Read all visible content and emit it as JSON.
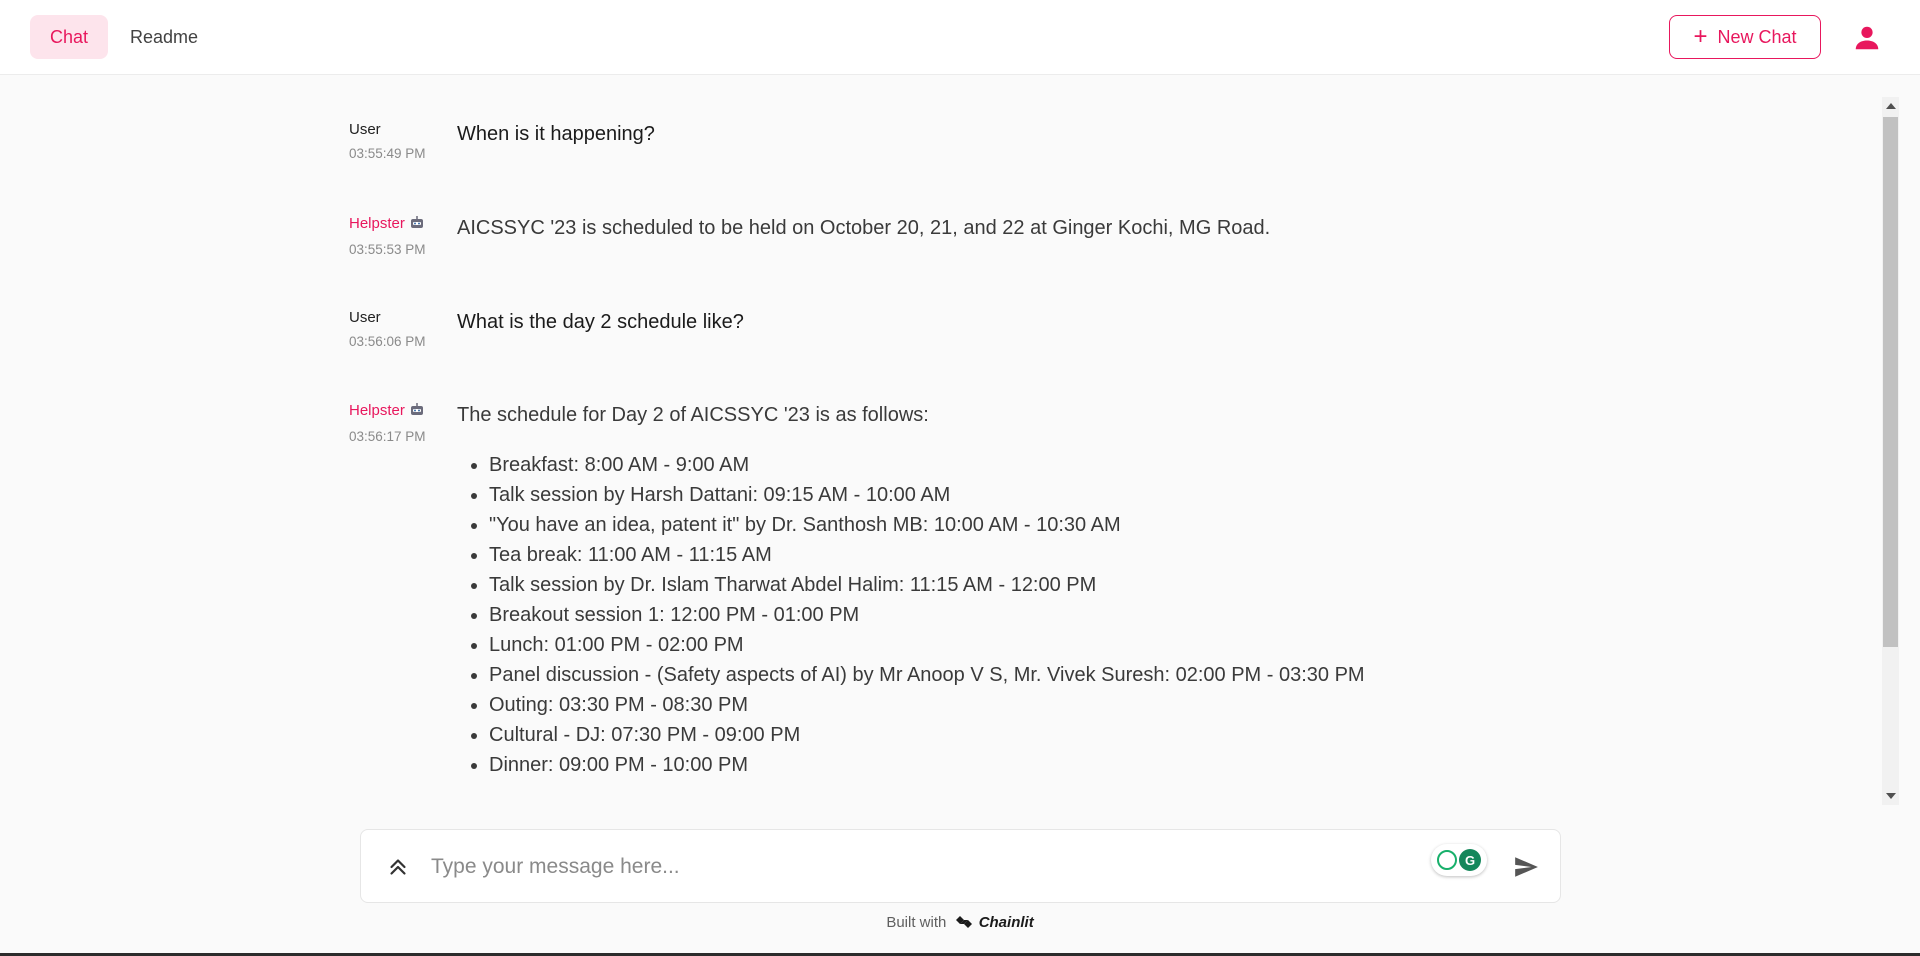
{
  "header": {
    "tabs": [
      {
        "label": "Chat",
        "active": true
      },
      {
        "label": "Readme",
        "active": false
      }
    ],
    "new_chat_label": "New Chat",
    "account_icon": "account-icon"
  },
  "colors": {
    "accent": "#e8175d",
    "active_tab_bg": "#fde4ec",
    "background": "#fafafa"
  },
  "messages": [
    {
      "author": "User",
      "time": "03:55:49 PM",
      "text": "When is it happening?"
    },
    {
      "author": "Helpster",
      "time": "03:55:53 PM",
      "text": "AICSSYC '23 is scheduled to be held on October 20, 21, and 22 at Ginger Kochi, MG Road."
    },
    {
      "author": "User",
      "time": "03:56:06 PM",
      "text": "What is the day 2 schedule like?"
    },
    {
      "author": "Helpster",
      "time": "03:56:17 PM",
      "text": "The schedule for Day 2 of AICSSYC '23 is as follows:",
      "items": [
        "Breakfast: 8:00 AM - 9:00 AM",
        "Talk session by Harsh Dattani: 09:15 AM - 10:00 AM",
        "\"You have an idea, patent it\" by Dr. Santhosh MB: 10:00 AM - 10:30 AM",
        "Tea break: 11:00 AM - 11:15 AM",
        "Talk session by Dr. Islam Tharwat Abdel Halim: 11:15 AM - 12:00 PM",
        "Breakout session 1: 12:00 PM - 01:00 PM",
        "Lunch: 01:00 PM - 02:00 PM",
        "Panel discussion - (Safety aspects of AI) by Mr Anoop V S, Mr. Vivek Suresh: 02:00 PM - 03:30 PM",
        "Outing: 03:30 PM - 08:30 PM",
        "Cultural - DJ: 07:30 PM - 09:00 PM",
        "Dinner: 09:00 PM - 10:00 PM"
      ]
    }
  ],
  "composer": {
    "placeholder": "Type your message here...",
    "value": ""
  },
  "footer": {
    "prefix": "Built with",
    "brand": "Chainlit"
  }
}
